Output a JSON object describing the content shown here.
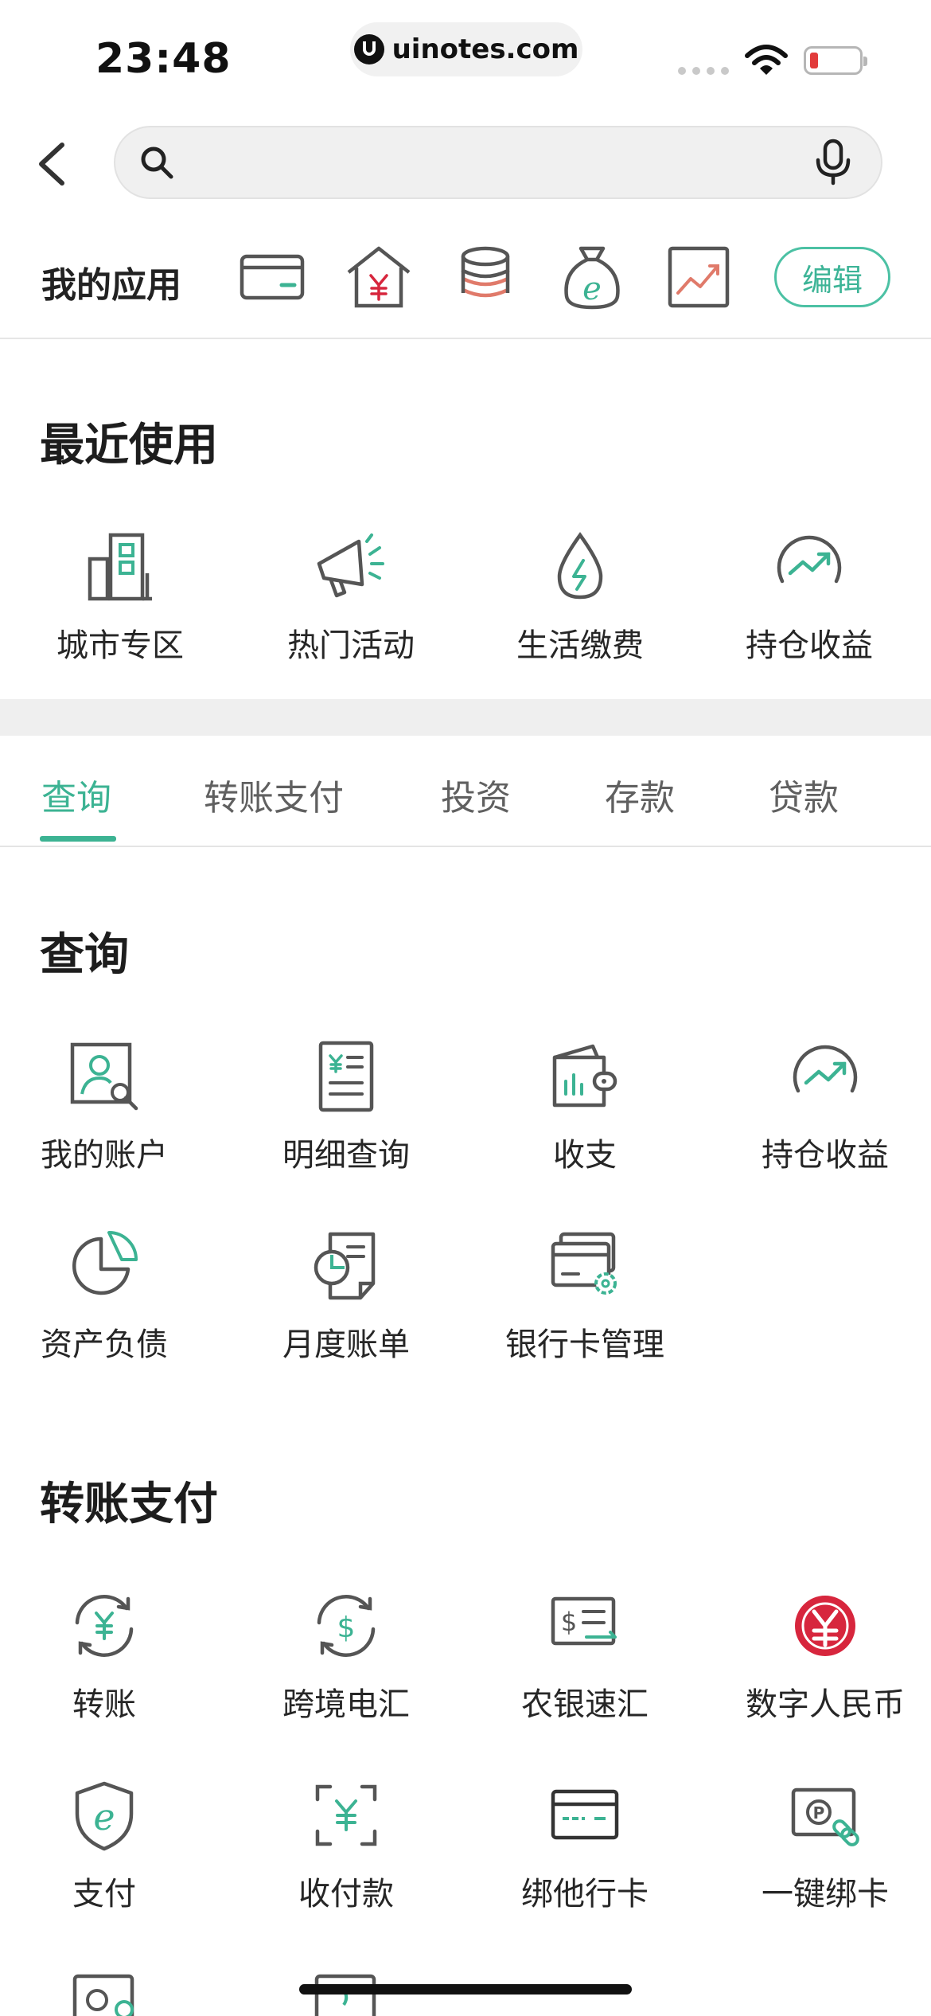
{
  "status_bar": {
    "time": "23:48",
    "url": "uinotes.com"
  },
  "search": {
    "placeholder": ""
  },
  "my_apps": {
    "label": "我的应用",
    "icons": [
      "card-icon",
      "house-yuan-icon",
      "coin-stack-icon",
      "e-money-bag-icon",
      "chart-trend-icon"
    ],
    "edit_label": "编辑"
  },
  "recent": {
    "title": "最近使用",
    "items": [
      {
        "label": "城市专区",
        "icon": "city-buildings-icon"
      },
      {
        "label": "热门活动",
        "icon": "megaphone-icon"
      },
      {
        "label": "生活缴费",
        "icon": "water-drop-bolt-icon"
      },
      {
        "label": "持仓收益",
        "icon": "holdings-trend-icon"
      }
    ]
  },
  "tabs": [
    {
      "label": "查询",
      "active": true
    },
    {
      "label": "转账支付",
      "active": false
    },
    {
      "label": "投资",
      "active": false
    },
    {
      "label": "存款",
      "active": false
    },
    {
      "label": "贷款",
      "active": false
    }
  ],
  "query_section": {
    "title": "查询",
    "items": [
      {
        "label": "我的账户",
        "icon": "account-search-icon"
      },
      {
        "label": "明细查询",
        "icon": "statement-icon"
      },
      {
        "label": "收支",
        "icon": "wallet-chart-icon"
      },
      {
        "label": "持仓收益",
        "icon": "holdings-trend-icon"
      },
      {
        "label": "资产负债",
        "icon": "pie-chart-icon"
      },
      {
        "label": "月度账单",
        "icon": "monthly-bill-icon"
      },
      {
        "label": "银行卡管理",
        "icon": "card-settings-icon"
      }
    ]
  },
  "transfer_section": {
    "title": "转账支付",
    "items": [
      {
        "label": "转账",
        "icon": "yuan-exchange-icon"
      },
      {
        "label": "跨境电汇",
        "icon": "dollar-exchange-icon"
      },
      {
        "label": "农银速汇",
        "icon": "fast-remit-icon"
      },
      {
        "label": "数字人民币",
        "icon": "digital-rmb-icon"
      },
      {
        "label": "支付",
        "icon": "e-pay-shield-icon"
      },
      {
        "label": "收付款",
        "icon": "scan-yuan-icon"
      },
      {
        "label": "绑他行卡",
        "icon": "bind-card-icon"
      },
      {
        "label": "一键绑卡",
        "icon": "one-click-bind-icon"
      }
    ]
  },
  "colors": {
    "accent": "#3cb393",
    "icon_stroke": "#555555",
    "red": "#d7263d"
  }
}
